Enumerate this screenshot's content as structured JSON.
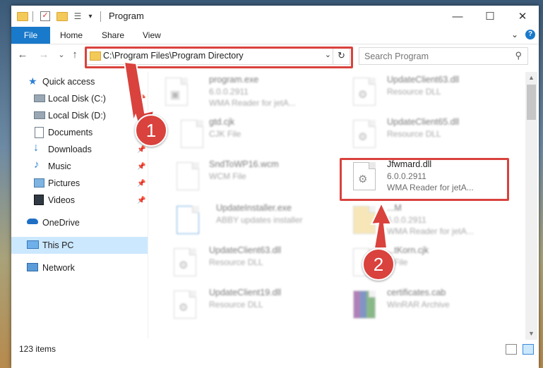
{
  "window": {
    "title": "Program",
    "controls": {
      "minimize": "—",
      "maximize": "☐",
      "close": "✕"
    }
  },
  "ribbon": {
    "file": "File",
    "tabs": [
      "Home",
      "Share",
      "View"
    ],
    "expand": "⌄",
    "help": "?"
  },
  "nav": {
    "back": "←",
    "forward": "→",
    "recent": "⌄",
    "up": "↑",
    "address": "C:\\Program Files\\Program Directory",
    "address_dropdown": "⌄",
    "refresh": "↻",
    "search_placeholder": "Search Program",
    "search_icon_glyph": "⚲"
  },
  "sidebar": {
    "items": [
      {
        "label": "Quick access",
        "icon": "star-icon",
        "pinned": false
      },
      {
        "label": "Local Disk (C:)",
        "icon": "drive-icon",
        "pinned": true
      },
      {
        "label": "Local Disk (D:)",
        "icon": "drive-icon",
        "pinned": true
      },
      {
        "label": "Documents",
        "icon": "documents-icon",
        "pinned": true
      },
      {
        "label": "Downloads",
        "icon": "download-icon",
        "pinned": true
      },
      {
        "label": "Music",
        "icon": "music-icon",
        "pinned": true
      },
      {
        "label": "Pictures",
        "icon": "pictures-icon",
        "pinned": true
      },
      {
        "label": "Videos",
        "icon": "videos-icon",
        "pinned": true
      },
      {
        "label": "OneDrive",
        "icon": "cloud-icon",
        "pinned": false
      },
      {
        "label": "This PC",
        "icon": "computer-icon",
        "pinned": false,
        "selected": true
      },
      {
        "label": "Network",
        "icon": "network-icon",
        "pinned": false
      }
    ],
    "pin_glyph": "📌"
  },
  "files": [
    {
      "name": "program.exe",
      "type": "6.0.0.2911",
      "desc": "WMA Reader for jetA...",
      "icon": "exe-icon",
      "blurred": true
    },
    {
      "name": "UpdateClient63.dll",
      "type": "Resource DLL",
      "desc": "",
      "icon": "dll-icon",
      "blurred": true
    },
    {
      "name": "gtd.cjk",
      "type": "CJK File",
      "desc": "",
      "icon": "file-icon",
      "blurred": true
    },
    {
      "name": "UpdateClient65.dll",
      "type": "Resource DLL",
      "desc": "",
      "icon": "dll-icon",
      "blurred": true
    },
    {
      "name": "SndToWP16.wcm",
      "type": "WCM File",
      "desc": "",
      "icon": "file-icon",
      "blurred": true
    },
    {
      "name": "Jfwmard.dll",
      "type": "6.0.0.2911",
      "desc": "WMA Reader for jetA...",
      "icon": "dll-icon",
      "blurred": false
    },
    {
      "name": "UpdateInstaller.exe",
      "type": "ABBY updates installer",
      "desc": "",
      "icon": "installer-icon",
      "blurred": true
    },
    {
      "name": "...M",
      "type": "6.0.0.2911",
      "desc": "WMA Reader for jetA...",
      "icon": "folder-icon",
      "blurred": true
    },
    {
      "name": "UpdateClient63.dll",
      "type": "Resource DLL",
      "desc": "",
      "icon": "dll-icon",
      "blurred": true
    },
    {
      "name": "...tKorn.cjk",
      "type": "...File",
      "desc": "",
      "icon": "file-icon",
      "blurred": true
    },
    {
      "name": "UpdateClient19.dll",
      "type": "Resource DLL",
      "desc": "",
      "icon": "dll-icon",
      "blurred": true
    },
    {
      "name": "certificates.cab",
      "type": "WinRAR Archive",
      "desc": "",
      "icon": "archive-icon",
      "blurred": true
    }
  ],
  "status": {
    "count": "123 items"
  },
  "callouts": {
    "one": "1",
    "two": "2"
  },
  "colors": {
    "accent": "#1979ca",
    "highlight": "#d9423d",
    "selected": "#cce8ff"
  }
}
